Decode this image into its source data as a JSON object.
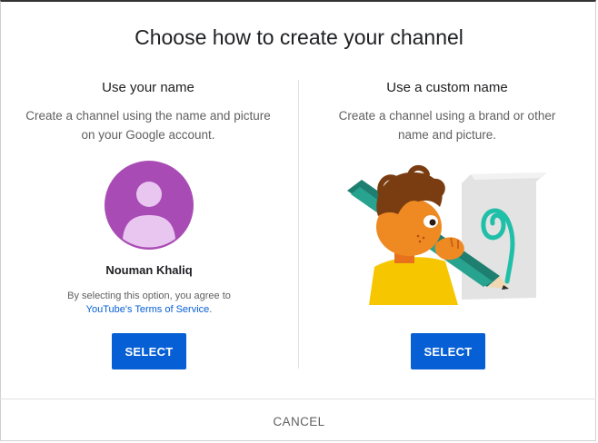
{
  "dialog": {
    "title": "Choose how to create your channel",
    "cancel_label": "CANCEL"
  },
  "options": {
    "own_name": {
      "heading": "Use your name",
      "description": "Create a channel using the name and picture on your Google account.",
      "account_name": "Nouman Khaliq",
      "agreement_text": "By selecting this option, you agree to",
      "tos_link": "YouTube's Terms of Service",
      "tos_suffix": ".",
      "select_label": "SELECT",
      "avatar_color": "#a94bb5"
    },
    "custom_name": {
      "heading": "Use a custom name",
      "description": "Create a channel using a brand or other name and picture.",
      "select_label": "SELECT"
    }
  },
  "colors": {
    "accent": "#065fd4",
    "text_secondary": "#606060"
  }
}
